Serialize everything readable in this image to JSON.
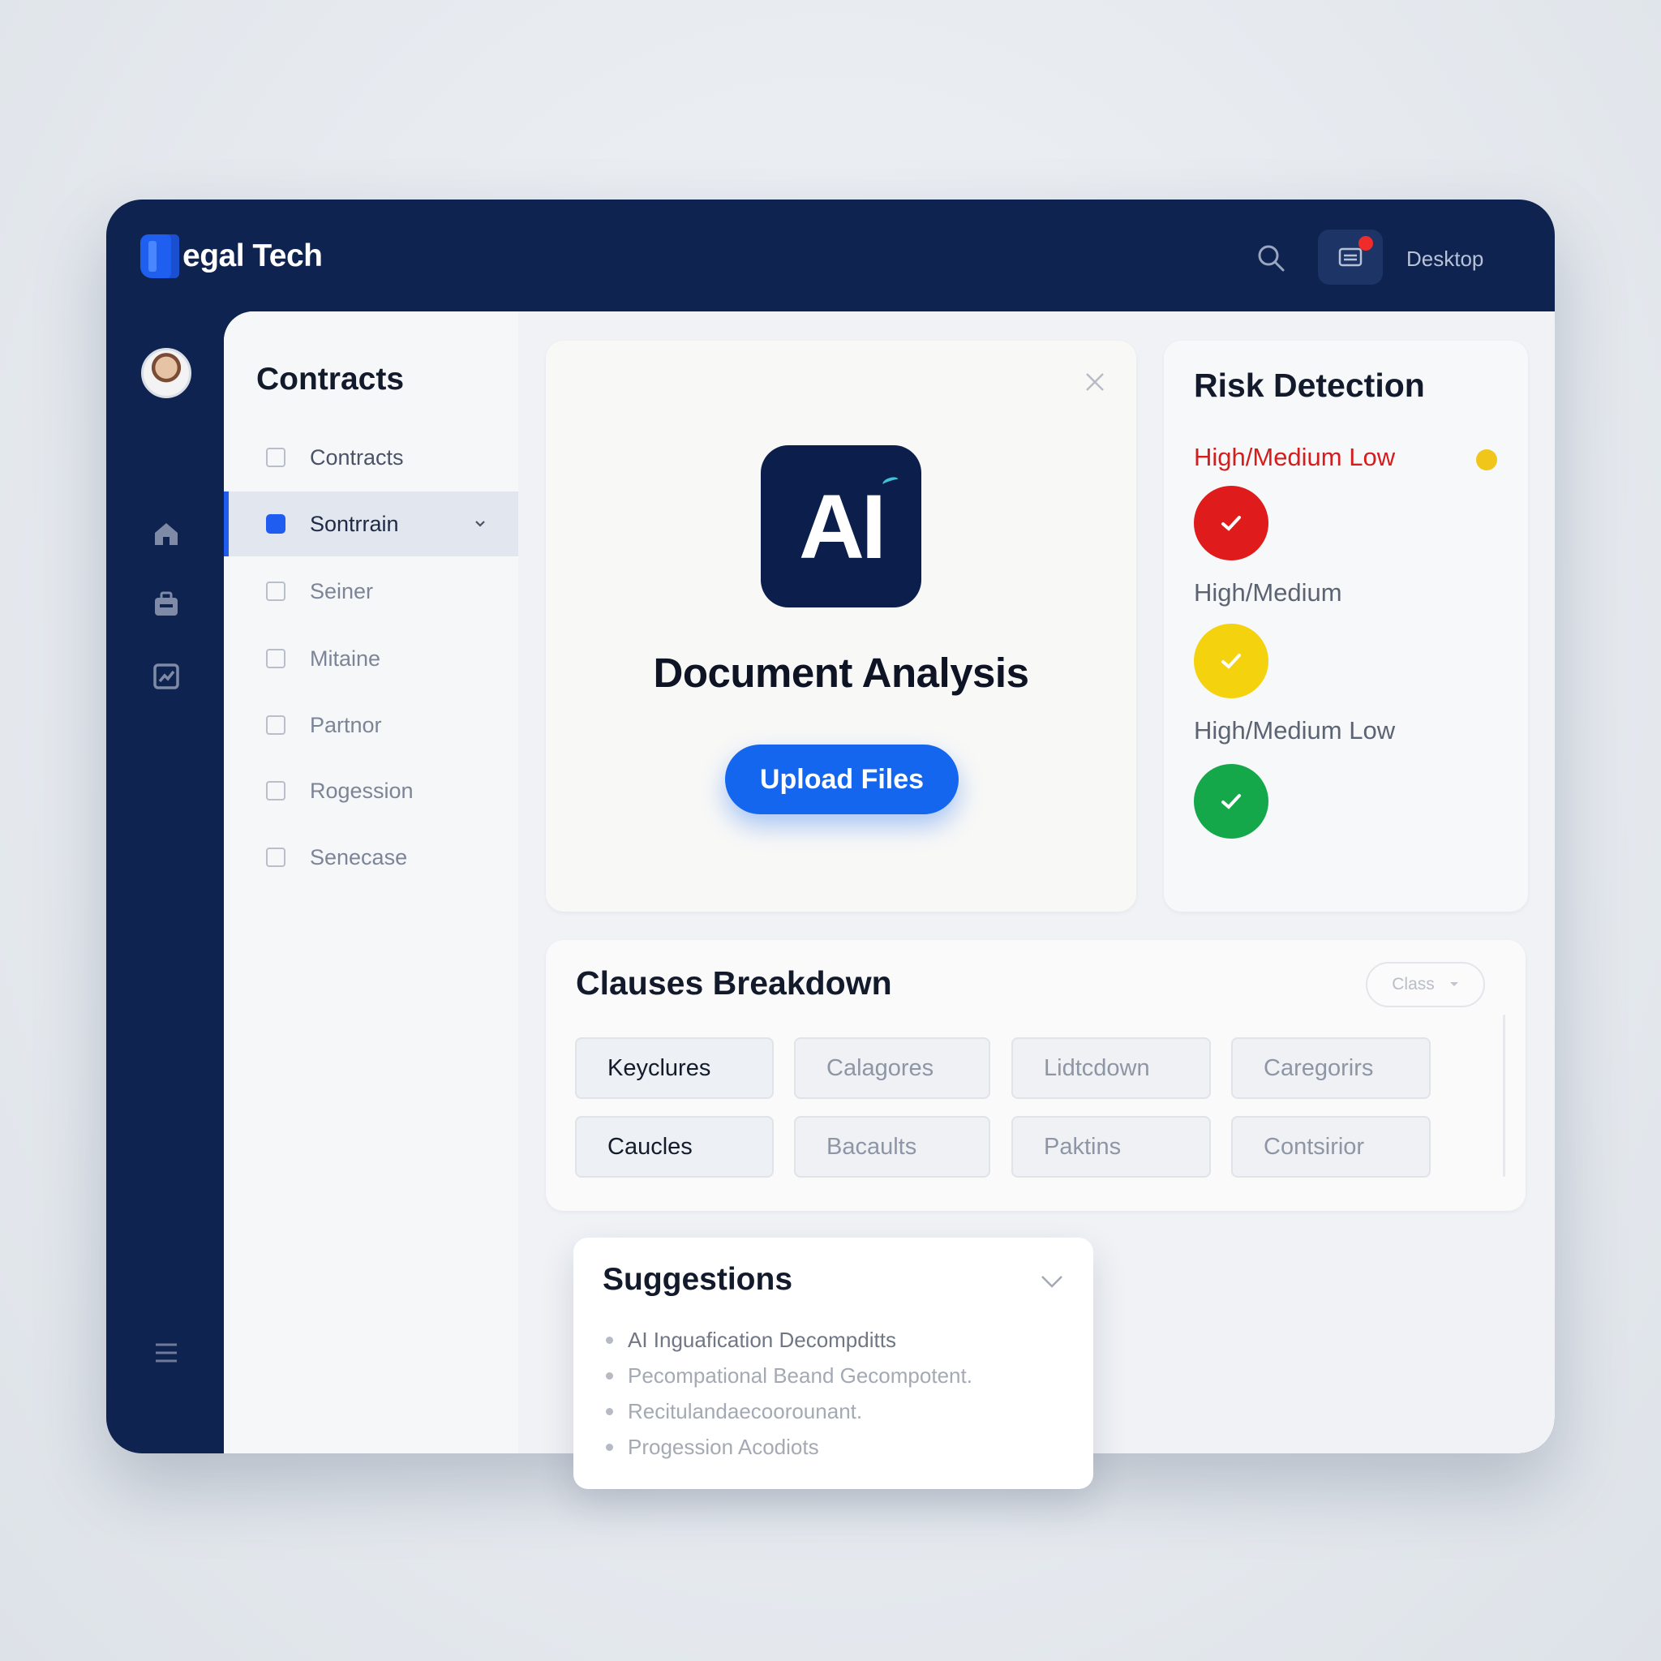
{
  "app": {
    "brand": "egal Tech",
    "top_label": "Desktop"
  },
  "icons": {
    "brand": "legal-tech-logo-icon",
    "search": "search-icon",
    "notifications": "inbox-icon",
    "home": "home-icon",
    "briefcase": "briefcase-icon",
    "reports": "reports-icon",
    "menu": "menu-icon"
  },
  "sidebar": {
    "title": "Contracts",
    "items": [
      {
        "label": "Contracts",
        "checked": false
      },
      {
        "label": "Sontrrain",
        "checked": true
      },
      {
        "label": "Seiner",
        "checked": false
      },
      {
        "label": "Mitaine",
        "checked": false
      },
      {
        "label": "Partnor",
        "checked": false
      },
      {
        "label": "Rogession",
        "checked": false
      },
      {
        "label": "Senecase",
        "checked": false
      }
    ]
  },
  "document": {
    "logo_text": "AI",
    "title": "Document Analysis",
    "upload_label": "Upload Files"
  },
  "risk": {
    "title": "Risk Detection",
    "levels": [
      {
        "label": "High/Medium Low",
        "color": "#e01b1b"
      },
      {
        "label": "High/Medium",
        "color": "#f4d20e"
      },
      {
        "label": "High/Medium Low",
        "color": "#14a84a"
      }
    ],
    "legend_color": "#f1c61a"
  },
  "clauses": {
    "title": "Clauses Breakdown",
    "filter_label": "Class",
    "chips": [
      "Keyclures",
      "Calagores",
      "Lidtcdown",
      "Caregorirs",
      "Caucles",
      "Bacaults",
      "Paktins",
      "Contsirior"
    ]
  },
  "suggestions": {
    "title": "Suggestions",
    "items": [
      "AI Inguafication Decompditts",
      "Pecompational Beand Gecompotent.",
      "Recitulandaecoorounant.",
      "Progession Acodiots"
    ]
  },
  "colors": {
    "accent": "#1566ef",
    "navy": "#0f2350"
  }
}
